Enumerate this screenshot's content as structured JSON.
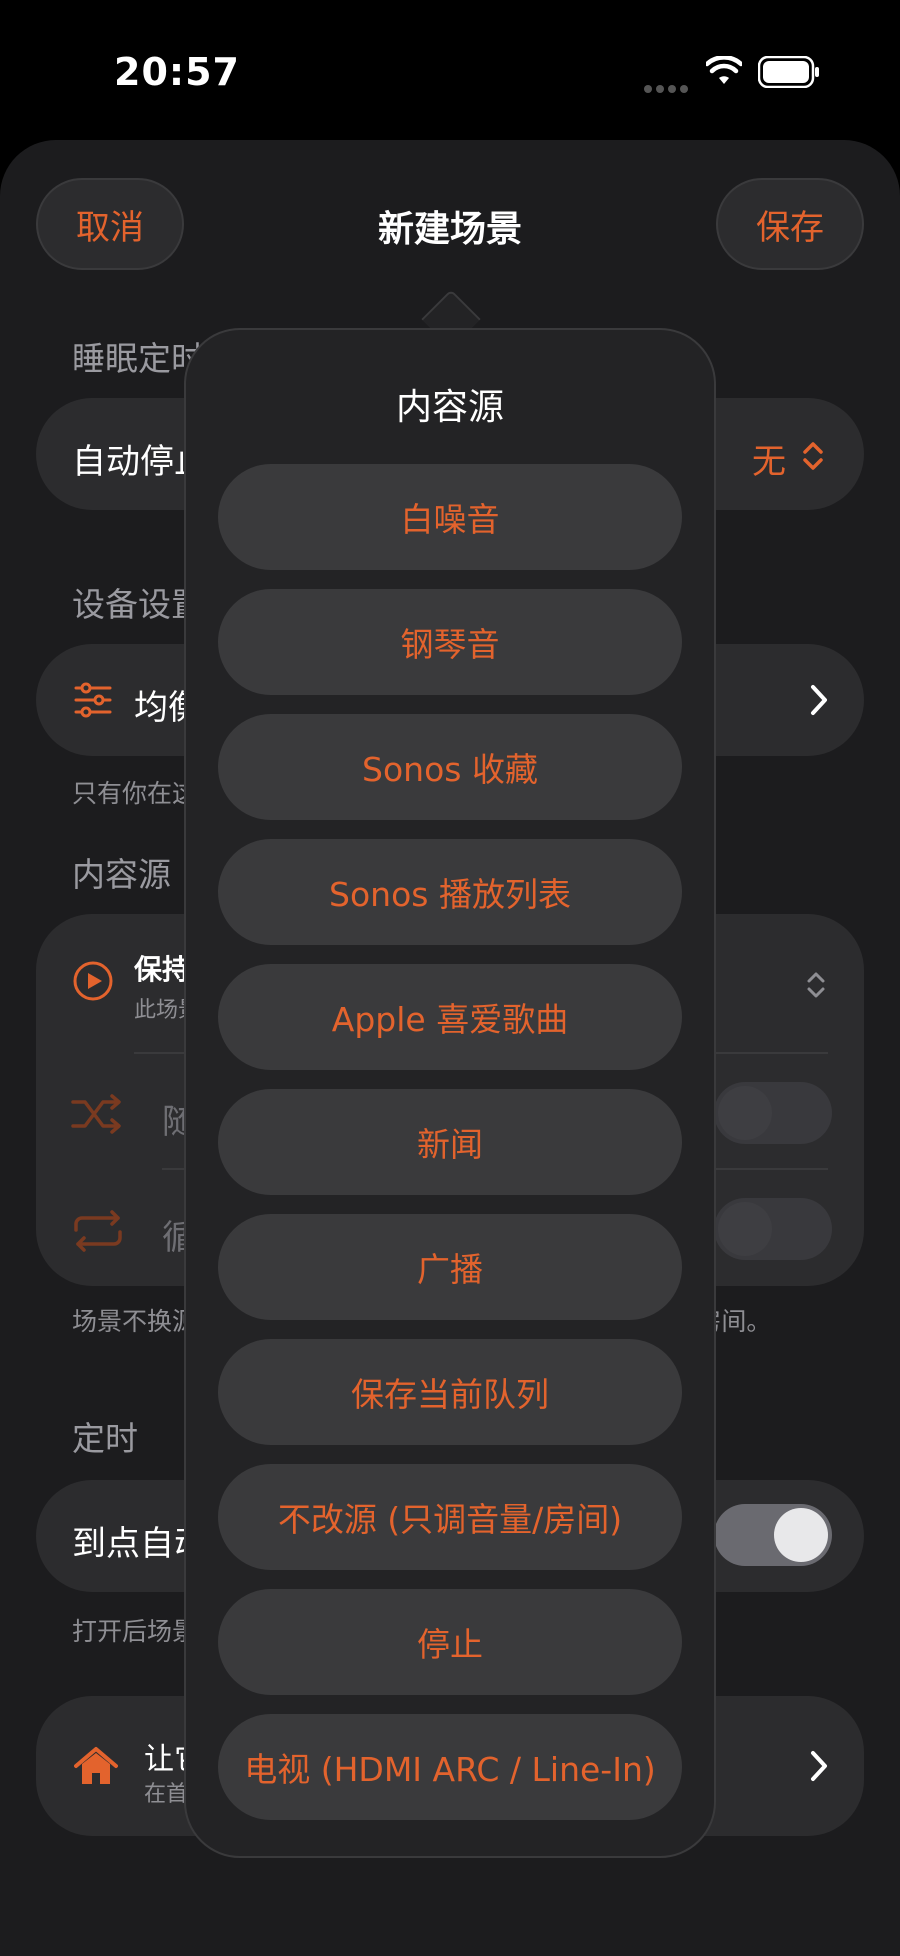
{
  "status": {
    "time": "20:57"
  },
  "nav": {
    "cancel": "取消",
    "title": "新建场景",
    "save": "保存"
  },
  "sleep": {
    "section": "睡眠定时",
    "row_label": "自动停止",
    "value": "无"
  },
  "device": {
    "section": "设备设置",
    "row_label": "均衡器",
    "footer": "只有你在这里设置的才会改，其他一律不碰。"
  },
  "content": {
    "section": "内容源",
    "source_title": "保持当前",
    "source_sub": "此场景不换源",
    "shuffle_label": "随机播放",
    "repeat_label": "循环播放",
    "footer": "场景不换源时，随机和循环不生效；可以静音 / 停止其他房间。"
  },
  "timer": {
    "section": "定时",
    "row_label": "到点自动执行",
    "footer": "打开后场景会在设定时间自动执行"
  },
  "home": {
    "title": "让它出现在首页",
    "sub": "在首页显示"
  },
  "popover": {
    "title": "内容源",
    "options": [
      "白噪音",
      "钢琴音",
      "Sonos 收藏",
      "Sonos 播放列表",
      "Apple 喜爱歌曲",
      "新闻",
      "广播",
      "保存当前队列",
      "不改源 (只调音量/房间)",
      "停止",
      "电视 (HDMI ARC / Line-In)"
    ]
  },
  "colors": {
    "accent": "#e3632d",
    "background": "#1c1c1e",
    "card": "#2c2c2e"
  }
}
